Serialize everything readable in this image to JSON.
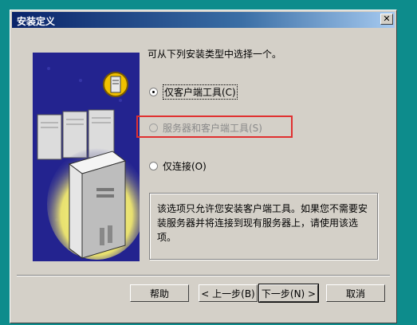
{
  "window": {
    "title": "安装定义",
    "close_glyph": "✕"
  },
  "prompt": "可从下列安装类型中选择一个。",
  "options": [
    {
      "label": "仅客户端工具(C)",
      "checked": true,
      "enabled": true
    },
    {
      "label": "服务器和客户端工具(S)",
      "checked": false,
      "enabled": false
    },
    {
      "label": "仅连接(O)",
      "checked": false,
      "enabled": true
    }
  ],
  "description": "该选项只允许您安装客户端工具。如果您不需要安装服务器并将连接到现有服务器上，请使用该选项。",
  "buttons": {
    "help": "帮助",
    "back": "< 上一步(B)",
    "next": "下一步(N) >",
    "cancel": "取消"
  },
  "colors": {
    "desktop": "#0d8c8c",
    "dialog": "#d4d0c8",
    "title_bar": "#0a246a",
    "highlight": "#e03030"
  },
  "icons": {
    "art": "server-illustration",
    "badge": "server-badge-icon"
  }
}
